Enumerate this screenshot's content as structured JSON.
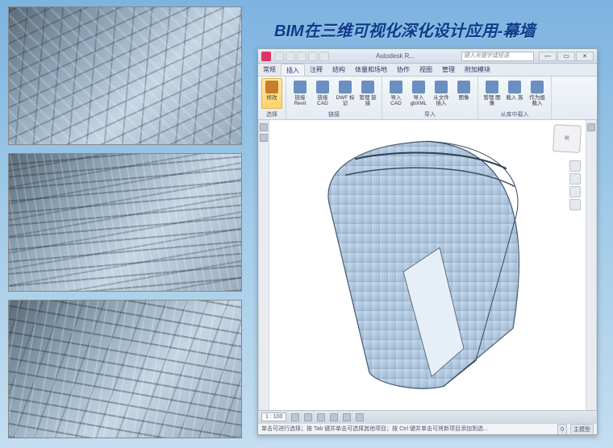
{
  "slide": {
    "title": "BIM在三维可视化深化设计应用-幕墙"
  },
  "app": {
    "title": "Autodesk R...",
    "search_placeholder": "键入关键字或短语",
    "win": {
      "min": "—",
      "max": "▭",
      "close": "×"
    },
    "tabs": [
      "常规",
      "插入",
      "注释",
      "结构",
      "体量和场地",
      "协作",
      "视图",
      "管理",
      "附加模块"
    ],
    "active_tab": 1,
    "ribbon": {
      "groups": [
        {
          "label": "选择",
          "buttons": [
            {
              "label": "修改",
              "hl": true
            }
          ]
        },
        {
          "label": "链接",
          "buttons": [
            {
              "label": "链接\nRevit"
            },
            {
              "label": "链接\nCAD"
            },
            {
              "label": "DWF\n标记"
            },
            {
              "label": "管理\n链接"
            }
          ]
        },
        {
          "label": "导入",
          "buttons": [
            {
              "label": "导入\nCAD"
            },
            {
              "label": "导入\ngbXML"
            },
            {
              "label": "从文件\n插入"
            },
            {
              "label": "图像"
            }
          ]
        },
        {
          "label": "",
          "buttons": [
            {
              "label": "管理\n图像"
            },
            {
              "label": "载入\n族"
            },
            {
              "label": "作为组\n载入"
            }
          ]
        },
        {
          "label": "从库中载入",
          "buttons": []
        }
      ]
    },
    "viewcube": "前",
    "status": {
      "scale": "1 : 100"
    },
    "hint": "单击可进行选择；按 Tab 键并单击可选择其他项目；按 Ctrl 键并单击可将新项目添加到选...",
    "hint_right": {
      "zero": "0",
      "mode": "主模型"
    }
  }
}
